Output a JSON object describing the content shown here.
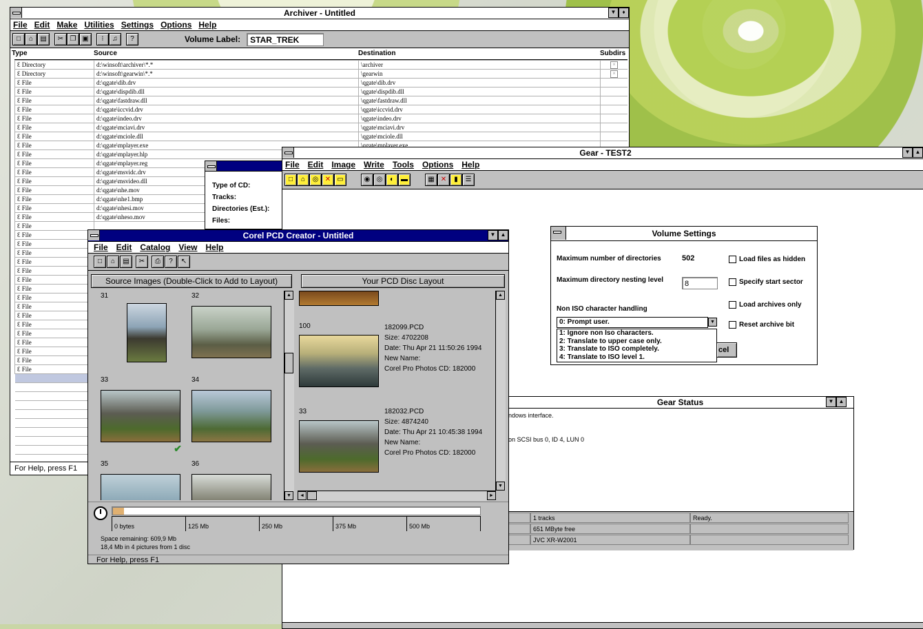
{
  "archiver": {
    "title": "Archiver - Untitled",
    "menu": [
      "File",
      "Edit",
      "Make",
      "Utilities",
      "Settings",
      "Options",
      "Help"
    ],
    "volume_label_caption": "Volume Label:",
    "volume_label_value": "STAR_TREK",
    "columns": {
      "type": "Type",
      "source": "Source",
      "destination": "Destination",
      "subdirs": "Subdirs"
    },
    "rows": [
      {
        "type": "Directory",
        "source": "d:\\winsoft\\archiver\\*.*",
        "dest": "\\archiver",
        "subdirs": true
      },
      {
        "type": "Directory",
        "source": "d:\\winsoft\\gearwin\\*.*",
        "dest": "\\gearwin",
        "subdirs": true
      },
      {
        "type": "File",
        "source": "d:\\qgate\\dib.drv",
        "dest": "\\qgate\\dib.drv"
      },
      {
        "type": "File",
        "source": "d:\\qgate\\dispdib.dll",
        "dest": "\\qgate\\dispdib.dll"
      },
      {
        "type": "File",
        "source": "d:\\qgate\\fastdraw.dll",
        "dest": "\\qgate\\fastdraw.dll"
      },
      {
        "type": "File",
        "source": "d:\\qgate\\iccvid.drv",
        "dest": "\\qgate\\iccvid.drv"
      },
      {
        "type": "File",
        "source": "d:\\qgate\\indeo.drv",
        "dest": "\\qgate\\indeo.drv"
      },
      {
        "type": "File",
        "source": "d:\\qgate\\mciavi.drv",
        "dest": "\\qgate\\mciavi.drv"
      },
      {
        "type": "File",
        "source": "d:\\qgate\\mciole.dll",
        "dest": "\\qgate\\mciole.dll"
      },
      {
        "type": "File",
        "source": "d:\\qgate\\mplayer.exe",
        "dest": "\\qgate\\mplayer.exe"
      },
      {
        "type": "File",
        "source": "d:\\qgate\\mplayer.hlp",
        "dest": ""
      },
      {
        "type": "File",
        "source": "d:\\qgate\\mplayer.reg",
        "dest": ""
      },
      {
        "type": "File",
        "source": "d:\\qgate\\msvidc.drv",
        "dest": ""
      },
      {
        "type": "File",
        "source": "d:\\qgate\\msvideo.dll",
        "dest": ""
      },
      {
        "type": "File",
        "source": "d:\\qgate\\nhe.mov",
        "dest": ""
      },
      {
        "type": "File",
        "source": "d:\\qgate\\nhe1.bmp",
        "dest": ""
      },
      {
        "type": "File",
        "source": "d:\\qgate\\nhesi.mov",
        "dest": ""
      },
      {
        "type": "File",
        "source": "d:\\qgate\\nheso.mov",
        "dest": ""
      },
      {
        "type": "File",
        "source": "",
        "dest": ""
      },
      {
        "type": "File",
        "source": "",
        "dest": ""
      },
      {
        "type": "File",
        "source": "",
        "dest": ""
      },
      {
        "type": "File",
        "source": "",
        "dest": ""
      },
      {
        "type": "File",
        "source": "",
        "dest": ""
      },
      {
        "type": "File",
        "source": "",
        "dest": ""
      },
      {
        "type": "File",
        "source": "",
        "dest": ""
      },
      {
        "type": "File",
        "source": "",
        "dest": ""
      },
      {
        "type": "File",
        "source": "",
        "dest": ""
      },
      {
        "type": "File",
        "source": "",
        "dest": ""
      },
      {
        "type": "File",
        "source": "",
        "dest": ""
      },
      {
        "type": "File",
        "source": "",
        "dest": ""
      },
      {
        "type": "File",
        "source": "",
        "dest": ""
      },
      {
        "type": "File",
        "source": "",
        "dest": ""
      },
      {
        "type": "File",
        "source": "",
        "dest": ""
      },
      {
        "type": "File",
        "source": "",
        "dest": ""
      },
      {
        "type": "File",
        "source": "",
        "dest": ""
      }
    ],
    "status": "For Help, press F1"
  },
  "cdinfo": {
    "labels": [
      "Type of CD:",
      "Tracks:",
      "Directories (Est.):",
      "Files:"
    ]
  },
  "gear": {
    "title": "Gear - TEST2",
    "menu": [
      "File",
      "Edit",
      "Image",
      "Write",
      "Tools",
      "Options",
      "Help"
    ]
  },
  "volume_settings": {
    "title": "Volume Settings",
    "max_dirs_label": "Maximum number of directories",
    "max_dirs_value": "502",
    "nesting_label": "Maximum directory nesting level",
    "nesting_value": "8",
    "non_iso_label": "Non ISO character handling",
    "selected": "0:  Prompt user.",
    "options": [
      "1:  Ignore non Iso characters.",
      "2:  Translate to upper case only.",
      "3:  Translate to ISO completely.",
      "4:  Translate to ISO level 1."
    ],
    "checkboxes": [
      "Load files as hidden",
      "Specify start sector",
      "Load archives only",
      "Reset archive bit"
    ],
    "cancel_fragment": "cel"
  },
  "gear_status": {
    "title": "Gear Status",
    "line1": "ndows interface.",
    "line2": "on SCSI bus 0, ID 4, LUN 0",
    "cells": [
      [
        "1 tracks",
        "Ready."
      ],
      [
        "651 MByte free",
        ""
      ],
      [
        "JVC XR-W2001",
        ""
      ]
    ]
  },
  "corel": {
    "title": "Corel PCD Creator - Untitled",
    "menu": [
      "File",
      "Edit",
      "Catalog",
      "View",
      "Help"
    ],
    "source_header": "Source Images (Double-Click to Add to Layout)",
    "layout_header": "Your PCD Disc Layout",
    "thumbs": [
      "31",
      "32",
      "33",
      "34",
      "35",
      "36"
    ],
    "layout_items": [
      {
        "num": "100",
        "file": "182099.PCD",
        "size": "Size: 4702208",
        "date": "Date: Thu Apr 21 11:50:26 1994",
        "newname": "New Name:",
        "cd": "Corel Pro Photos CD: 182000"
      },
      {
        "num": "33",
        "file": "182032.PCD",
        "size": "Size: 4874240",
        "date": "Date: Thu Apr 21 10:45:38 1994",
        "newname": "New Name:",
        "cd": "Corel Pro Photos CD: 182000"
      }
    ],
    "ruler": [
      "0 bytes",
      "125 Mb",
      "250 Mb",
      "375 Mb",
      "500 Mb"
    ],
    "usage_fraction": 0.03,
    "space_remaining": "Space remaining: 609,9 Mb",
    "pictures_info": "18,4 Mb in 4 pictures from 1 disc",
    "status": "For Help, press F1"
  }
}
